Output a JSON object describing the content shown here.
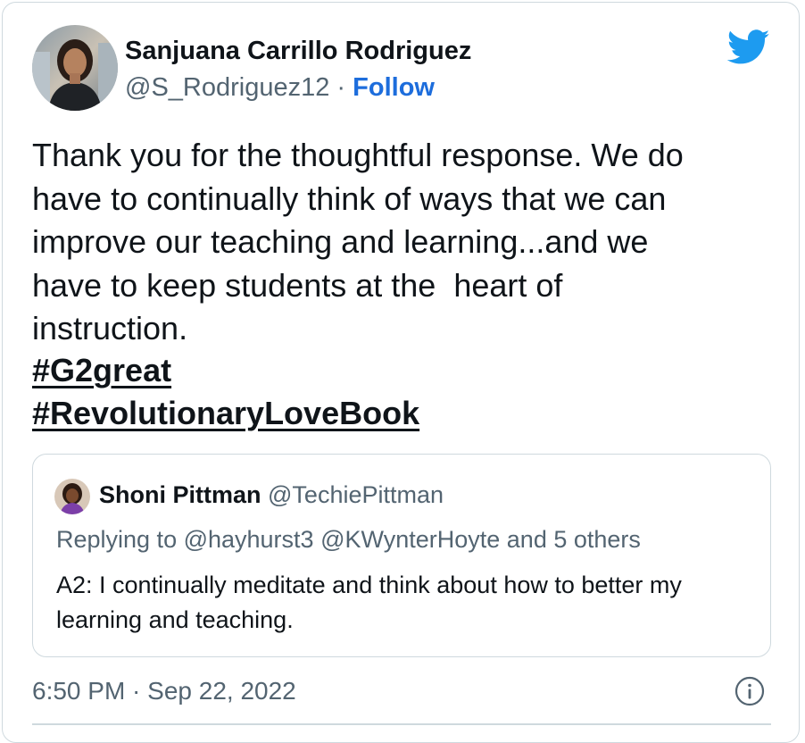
{
  "author": {
    "name": "Sanjuana Carrillo Rodriguez",
    "handle": "@S_Rodriguez12",
    "separator": "·",
    "follow_label": "Follow"
  },
  "icons": {
    "brand": "twitter-bird-icon",
    "info": "info-icon"
  },
  "tweet": {
    "lines": [
      "Thank you for the thoughtful response. We do",
      "have to continually think of ways that we can",
      "improve our teaching and learning...and we",
      "have to keep students at the  heart of",
      "instruction."
    ],
    "hashtags": [
      "#G2great",
      "#RevolutionaryLoveBook"
    ]
  },
  "quoted_tweet": {
    "name": "Shoni Pittman",
    "handle": "@TechiePittman",
    "replying_to": "Replying to @hayhurst3 @KWynterHoyte and 5 others",
    "body": "A2: I continually meditate and think about how to better my learning and teaching."
  },
  "timestamp": "6:50 PM · Sep 22, 2022",
  "colors": {
    "link_blue": "#1d6ddc",
    "twitter_blue": "#1d9bf0",
    "muted_text": "#536471",
    "border": "#cfd9de"
  }
}
